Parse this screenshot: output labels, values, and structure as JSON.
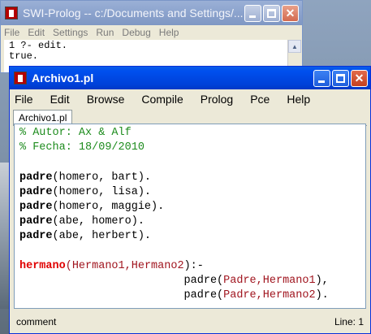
{
  "back_window": {
    "title": "SWI-Prolog -- c:/Documents and Settings/...",
    "menu": [
      "File",
      "Edit",
      "Settings",
      "Run",
      "Debug",
      "Help"
    ],
    "console_lines": [
      "1 ?- edit.",
      "true."
    ]
  },
  "front_window": {
    "title": "Archivo1.pl",
    "menu": [
      "File",
      "Edit",
      "Browse",
      "Compile",
      "Prolog",
      "Pce",
      "Help"
    ],
    "tab_label": "Archivo1.pl",
    "code": {
      "comment1": "% Autor: Ax & Alf",
      "comment2": "% Fecha: 18/09/2010",
      "facts": [
        {
          "head": "padre",
          "args": "(homero, bart)."
        },
        {
          "head": "padre",
          "args": "(homero, lisa)."
        },
        {
          "head": "padre",
          "args": "(homero, maggie)."
        },
        {
          "head": "padre",
          "args": "(abe, homero)."
        },
        {
          "head": "padre",
          "args": "(abe, herbert)."
        }
      ],
      "rule": {
        "head": "hermano",
        "open": "(",
        "vars": "Hermano1,Hermano2",
        "close": "):-",
        "body1_pred": "padre(",
        "body1_vars": "Padre,Hermano1",
        "body1_end": "),",
        "body2_pred": "padre(",
        "body2_vars": "Padre,Hermano2",
        "body2_end": ")."
      }
    },
    "status_left": "comment",
    "status_right": "Line: 1"
  },
  "colors": {
    "comment": "#1e8c1e",
    "rule_head": "#e00000",
    "variable": "#a0141e",
    "xp_title_blue": "#0050ee"
  }
}
